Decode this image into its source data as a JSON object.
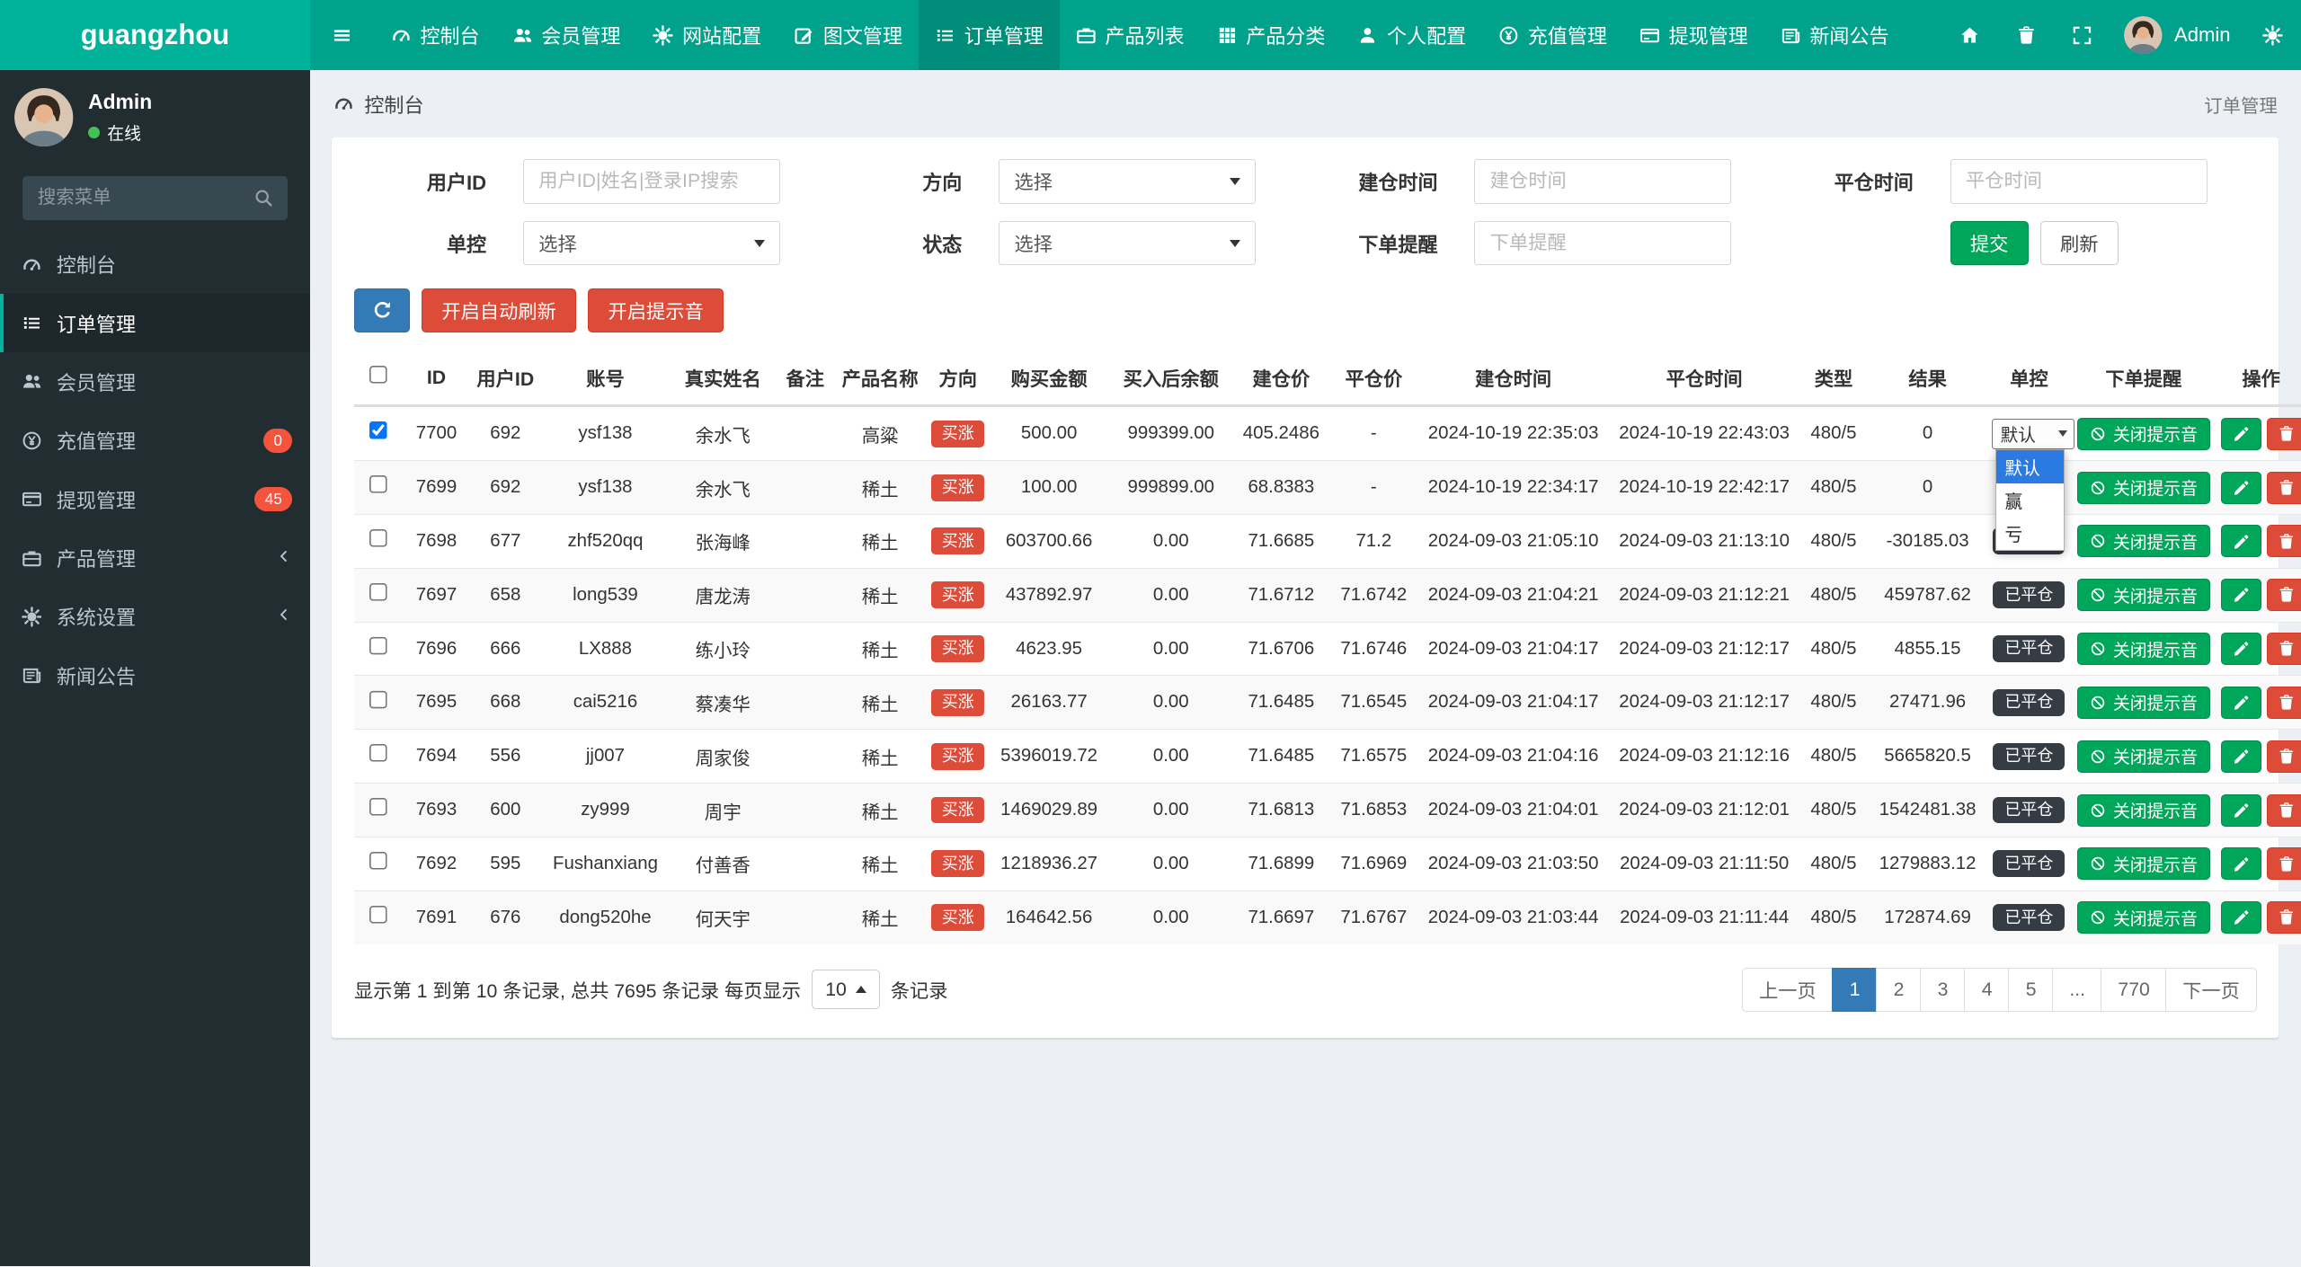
{
  "colors": {
    "logo-bg": "#00b29a",
    "navbar-bg": "#00a28c",
    "navbar-active": "#008d79",
    "sidebar-bg": "#222d32",
    "sidebar-active": "#1e282c",
    "success": "#00a65a",
    "danger": "#dd4b39",
    "primary": "#337ab7",
    "badge": "#f4543c",
    "closed": "#363c44",
    "content-bg": "#ecf0f5",
    "drop-hl": "#2a7ae2"
  },
  "brand": "guangzhou",
  "topnav": {
    "items": [
      {
        "icon": "dashboard",
        "label": "控制台"
      },
      {
        "icon": "users",
        "label": "会员管理"
      },
      {
        "icon": "gear",
        "label": "网站配置"
      },
      {
        "icon": "edit",
        "label": "图文管理"
      },
      {
        "icon": "list",
        "label": "订单管理",
        "active": true
      },
      {
        "icon": "briefcase",
        "label": "产品列表"
      },
      {
        "icon": "grid",
        "label": "产品分类"
      },
      {
        "icon": "user",
        "label": "个人配置"
      },
      {
        "icon": "recharge",
        "label": "充值管理"
      },
      {
        "icon": "withdraw",
        "label": "提现管理"
      },
      {
        "icon": "news",
        "label": "新闻公告"
      }
    ],
    "username": "Admin"
  },
  "sidebar": {
    "user": {
      "name": "Admin",
      "status": "在线"
    },
    "search_placeholder": "搜索菜单",
    "items": [
      {
        "icon": "dashboard",
        "label": "控制台"
      },
      {
        "icon": "list",
        "label": "订单管理",
        "active": true
      },
      {
        "icon": "users",
        "label": "会员管理"
      },
      {
        "icon": "recharge",
        "label": "充值管理",
        "badge": "0"
      },
      {
        "icon": "withdraw",
        "label": "提现管理",
        "badge": "45"
      },
      {
        "icon": "briefcase",
        "label": "产品管理",
        "chevron": true
      },
      {
        "icon": "gear",
        "label": "系统设置",
        "chevron": true
      },
      {
        "icon": "news",
        "label": "新闻公告"
      }
    ]
  },
  "breadcrumb": {
    "left": "控制台",
    "right": "订单管理"
  },
  "filters": {
    "row1": [
      {
        "label": "用户ID",
        "type": "input",
        "placeholder": "用户ID|姓名|登录IP搜索"
      },
      {
        "label": "方向",
        "type": "select",
        "value": "选择"
      },
      {
        "label": "建仓时间",
        "type": "input",
        "placeholder": "建仓时间"
      },
      {
        "label": "平仓时间",
        "type": "input",
        "placeholder": "平仓时间"
      }
    ],
    "row2": [
      {
        "label": "单控",
        "type": "select",
        "value": "选择"
      },
      {
        "label": "状态",
        "type": "select",
        "value": "选择"
      },
      {
        "label": "下单提醒",
        "type": "input",
        "placeholder": "下单提醒"
      }
    ],
    "submit": "提交",
    "refresh": "刷新"
  },
  "toolbar": {
    "auto_refresh": "开启自动刷新",
    "sound": "开启提示音"
  },
  "table": {
    "headers": [
      "ID",
      "用户ID",
      "账号",
      "真实姓名",
      "备注",
      "产品名称",
      "方向",
      "购买金额",
      "买入后余额",
      "建仓价",
      "平仓价",
      "建仓时间",
      "平仓时间",
      "类型",
      "结果",
      "单控",
      "下单提醒",
      "操作"
    ],
    "closed_badge": "已平仓",
    "sound_off_label": "关闭提示音",
    "dropdown": {
      "value": "默认",
      "options": [
        "默认",
        "赢",
        "亏"
      ]
    },
    "rows": [
      {
        "checked": true,
        "id": "7700",
        "uid": "692",
        "account": "ysf138",
        "name": "余水飞",
        "note": "",
        "product": "高粱",
        "direction": "买涨",
        "amount": "500.00",
        "balance": "999399.00",
        "open_price": "405.2486",
        "close_price": "-",
        "open_time": "2024-10-19 22:35:03",
        "close_time": "2024-10-19 22:43:03",
        "type": "480/5",
        "result": "0",
        "control": "dropdown"
      },
      {
        "checked": false,
        "id": "7699",
        "uid": "692",
        "account": "ysf138",
        "name": "余水飞",
        "note": "",
        "product": "稀土",
        "direction": "买涨",
        "amount": "100.00",
        "balance": "999899.00",
        "open_price": "68.8383",
        "close_price": "-",
        "open_time": "2024-10-19 22:34:17",
        "close_time": "2024-10-19 22:42:17",
        "type": "480/5",
        "result": "0",
        "control": "hidden"
      },
      {
        "checked": false,
        "id": "7698",
        "uid": "677",
        "account": "zhf520qq",
        "name": "张海峰",
        "note": "",
        "product": "稀土",
        "direction": "买涨",
        "amount": "603700.66",
        "balance": "0.00",
        "open_price": "71.6685",
        "close_price": "71.2",
        "open_time": "2024-09-03 21:05:10",
        "close_time": "2024-09-03 21:13:10",
        "type": "480/5",
        "result": "-30185.03",
        "control": "closed"
      },
      {
        "checked": false,
        "id": "7697",
        "uid": "658",
        "account": "long539",
        "name": "唐龙涛",
        "note": "",
        "product": "稀土",
        "direction": "买涨",
        "amount": "437892.97",
        "balance": "0.00",
        "open_price": "71.6712",
        "close_price": "71.6742",
        "open_time": "2024-09-03 21:04:21",
        "close_time": "2024-09-03 21:12:21",
        "type": "480/5",
        "result": "459787.62",
        "control": "closed"
      },
      {
        "checked": false,
        "id": "7696",
        "uid": "666",
        "account": "LX888",
        "name": "练小玲",
        "note": "",
        "product": "稀土",
        "direction": "买涨",
        "amount": "4623.95",
        "balance": "0.00",
        "open_price": "71.6706",
        "close_price": "71.6746",
        "open_time": "2024-09-03 21:04:17",
        "close_time": "2024-09-03 21:12:17",
        "type": "480/5",
        "result": "4855.15",
        "control": "closed"
      },
      {
        "checked": false,
        "id": "7695",
        "uid": "668",
        "account": "cai5216",
        "name": "蔡凑华",
        "note": "",
        "product": "稀土",
        "direction": "买涨",
        "amount": "26163.77",
        "balance": "0.00",
        "open_price": "71.6485",
        "close_price": "71.6545",
        "open_time": "2024-09-03 21:04:17",
        "close_time": "2024-09-03 21:12:17",
        "type": "480/5",
        "result": "27471.96",
        "control": "closed"
      },
      {
        "checked": false,
        "id": "7694",
        "uid": "556",
        "account": "jj007",
        "name": "周家俊",
        "note": "",
        "product": "稀土",
        "direction": "买涨",
        "amount": "5396019.72",
        "balance": "0.00",
        "open_price": "71.6485",
        "close_price": "71.6575",
        "open_time": "2024-09-03 21:04:16",
        "close_time": "2024-09-03 21:12:16",
        "type": "480/5",
        "result": "5665820.5",
        "control": "closed"
      },
      {
        "checked": false,
        "id": "7693",
        "uid": "600",
        "account": "zy999",
        "name": "周宇",
        "note": "",
        "product": "稀土",
        "direction": "买涨",
        "amount": "1469029.89",
        "balance": "0.00",
        "open_price": "71.6813",
        "close_price": "71.6853",
        "open_time": "2024-09-03 21:04:01",
        "close_time": "2024-09-03 21:12:01",
        "type": "480/5",
        "result": "1542481.38",
        "control": "closed"
      },
      {
        "checked": false,
        "id": "7692",
        "uid": "595",
        "account": "Fushanxiang",
        "name": "付善香",
        "note": "",
        "product": "稀土",
        "direction": "买涨",
        "amount": "1218936.27",
        "balance": "0.00",
        "open_price": "71.6899",
        "close_price": "71.6969",
        "open_time": "2024-09-03 21:03:50",
        "close_time": "2024-09-03 21:11:50",
        "type": "480/5",
        "result": "1279883.12",
        "control": "closed"
      },
      {
        "checked": false,
        "id": "7691",
        "uid": "676",
        "account": "dong520he",
        "name": "何天宇",
        "note": "",
        "product": "稀土",
        "direction": "买涨",
        "amount": "164642.56",
        "balance": "0.00",
        "open_price": "71.6697",
        "close_price": "71.6767",
        "open_time": "2024-09-03 21:03:44",
        "close_time": "2024-09-03 21:11:44",
        "type": "480/5",
        "result": "172874.69",
        "control": "closed"
      }
    ]
  },
  "footer": {
    "summary": "显示第 1 到第 10 条记录, 总共 7695 条记录 每页显示",
    "page_size": "10",
    "summary_suffix": "条记录",
    "pagination": [
      "上一页",
      "1",
      "2",
      "3",
      "4",
      "5",
      "...",
      "770",
      "下一页"
    ],
    "active_page": "1"
  }
}
